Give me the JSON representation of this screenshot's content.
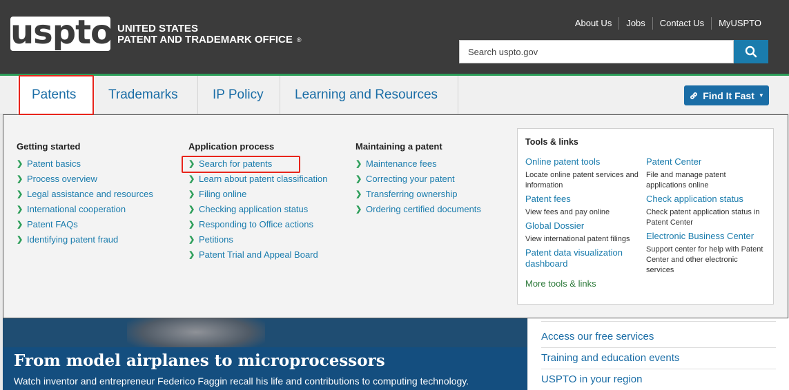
{
  "header": {
    "logo_text": "uspto",
    "agency_line1": "UNITED STATES",
    "agency_line2": "PATENT AND TRADEMARK OFFICE",
    "registered": "®",
    "utility_links": [
      "About Us",
      "Jobs",
      "Contact Us",
      "MyUSPTO"
    ],
    "search_placeholder": "Search uspto.gov"
  },
  "nav": {
    "items": [
      "Patents",
      "Trademarks",
      "IP Policy",
      "Learning and Resources"
    ],
    "active": "Patents",
    "find_it_fast": "Find It Fast"
  },
  "menu": {
    "columns": [
      {
        "heading": "Getting started",
        "links": [
          "Patent basics",
          "Process overview",
          "Legal assistance and resources",
          "International cooperation",
          "Patent FAQs",
          "Identifying patent fraud"
        ]
      },
      {
        "heading": "Application process",
        "links": [
          "Search for patents",
          "Learn about patent classification",
          "Filing online",
          "Checking application status",
          "Responding to Office actions",
          "Petitions",
          "Patent Trial and Appeal Board"
        ]
      },
      {
        "heading": "Maintaining a patent",
        "links": [
          "Maintenance fees",
          "Correcting your patent",
          "Transferring ownership",
          "Ordering certified documents"
        ]
      }
    ],
    "tools": {
      "heading": "Tools & links",
      "left": [
        {
          "link": "Online patent tools",
          "desc": "Locate online patent services and information"
        },
        {
          "link": "Patent fees",
          "desc": "View fees and pay online"
        },
        {
          "link": "Global Dossier",
          "desc": "View international patent filings"
        },
        {
          "link": "Patent data visualization dashboard",
          "desc": ""
        }
      ],
      "right": [
        {
          "link": "Patent Center",
          "desc": "File and manage patent applications online"
        },
        {
          "link": "Check application status",
          "desc": "Check patent application status in Patent Center"
        },
        {
          "link": "Electronic Business Center",
          "desc": "Support center for help with Patent Center and other electronic services"
        }
      ],
      "more": "More tools & links"
    }
  },
  "hero": {
    "title": "From model airplanes to microprocessors",
    "subtitle": "Watch inventor and entrepreneur Federico Faggin recall his life and contributions to computing technology."
  },
  "side_links": [
    "Access our free services",
    "Training and education events",
    "USPTO in your region"
  ],
  "colors": {
    "header_bg": "#3b3b3b",
    "brand_blue": "#1a6da6",
    "accent_green": "#2d9e5a",
    "highlight_red": "#e8241b"
  }
}
